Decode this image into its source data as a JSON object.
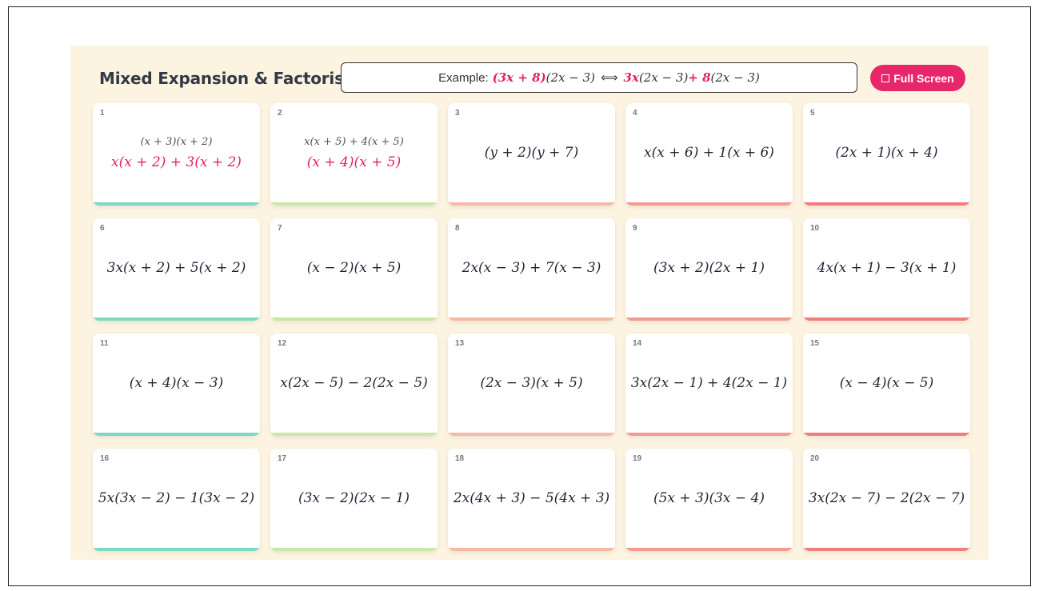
{
  "title": "Mixed Expansion & Factorising",
  "example": {
    "label": "Example:",
    "left_hl": "(3x + 8)",
    "left_rest": "(2x − 3)",
    "arrow": "⟺",
    "right_hl1": "3x",
    "right_rest1": "(2x − 3) ",
    "right_hl2": "+ 8",
    "right_rest2": "(2x − 3)"
  },
  "full_screen_button": {
    "label": "Full Screen",
    "icon": "fullscreen-icon"
  },
  "colors": {
    "accent": "#e8276a",
    "answer": "#e4215f",
    "panel_bg": "#fcf4e0",
    "bar_col1": "#7dd8c4",
    "bar_col2": "#c9e8a6",
    "bar_col3": "#f8b9a3",
    "bar_col4": "#f59a90",
    "bar_col5": "#f27d7d"
  },
  "cards": [
    {
      "num": "1",
      "expr": "(x + 3)(x + 2)",
      "answer": "x(x + 2) + 3(x + 2)",
      "revealed": true
    },
    {
      "num": "2",
      "expr": "x(x + 5) + 4(x + 5)",
      "answer": "(x + 4)(x + 5)",
      "revealed": true
    },
    {
      "num": "3",
      "expr": "(y + 2)(y + 7)"
    },
    {
      "num": "4",
      "expr": "x(x + 6) + 1(x + 6)"
    },
    {
      "num": "5",
      "expr": "(2x + 1)(x + 4)"
    },
    {
      "num": "6",
      "expr": "3x(x + 2) + 5(x + 2)"
    },
    {
      "num": "7",
      "expr": "(x − 2)(x + 5)"
    },
    {
      "num": "8",
      "expr": "2x(x − 3) + 7(x − 3)"
    },
    {
      "num": "9",
      "expr": "(3x + 2)(2x + 1)"
    },
    {
      "num": "10",
      "expr": "4x(x + 1) − 3(x + 1)"
    },
    {
      "num": "11",
      "expr": "(x + 4)(x − 3)"
    },
    {
      "num": "12",
      "expr": "x(2x − 5) − 2(2x − 5)"
    },
    {
      "num": "13",
      "expr": "(2x − 3)(x + 5)"
    },
    {
      "num": "14",
      "expr": "3x(2x − 1) + 4(2x − 1)"
    },
    {
      "num": "15",
      "expr": "(x − 4)(x − 5)"
    },
    {
      "num": "16",
      "expr": "5x(3x − 2) − 1(3x − 2)"
    },
    {
      "num": "17",
      "expr": "(3x − 2)(2x − 1)"
    },
    {
      "num": "18",
      "expr": "2x(4x + 3) − 5(4x + 3)"
    },
    {
      "num": "19",
      "expr": "(5x + 3)(3x − 4)"
    },
    {
      "num": "20",
      "expr": "3x(2x − 7) − 2(2x − 7)"
    }
  ]
}
